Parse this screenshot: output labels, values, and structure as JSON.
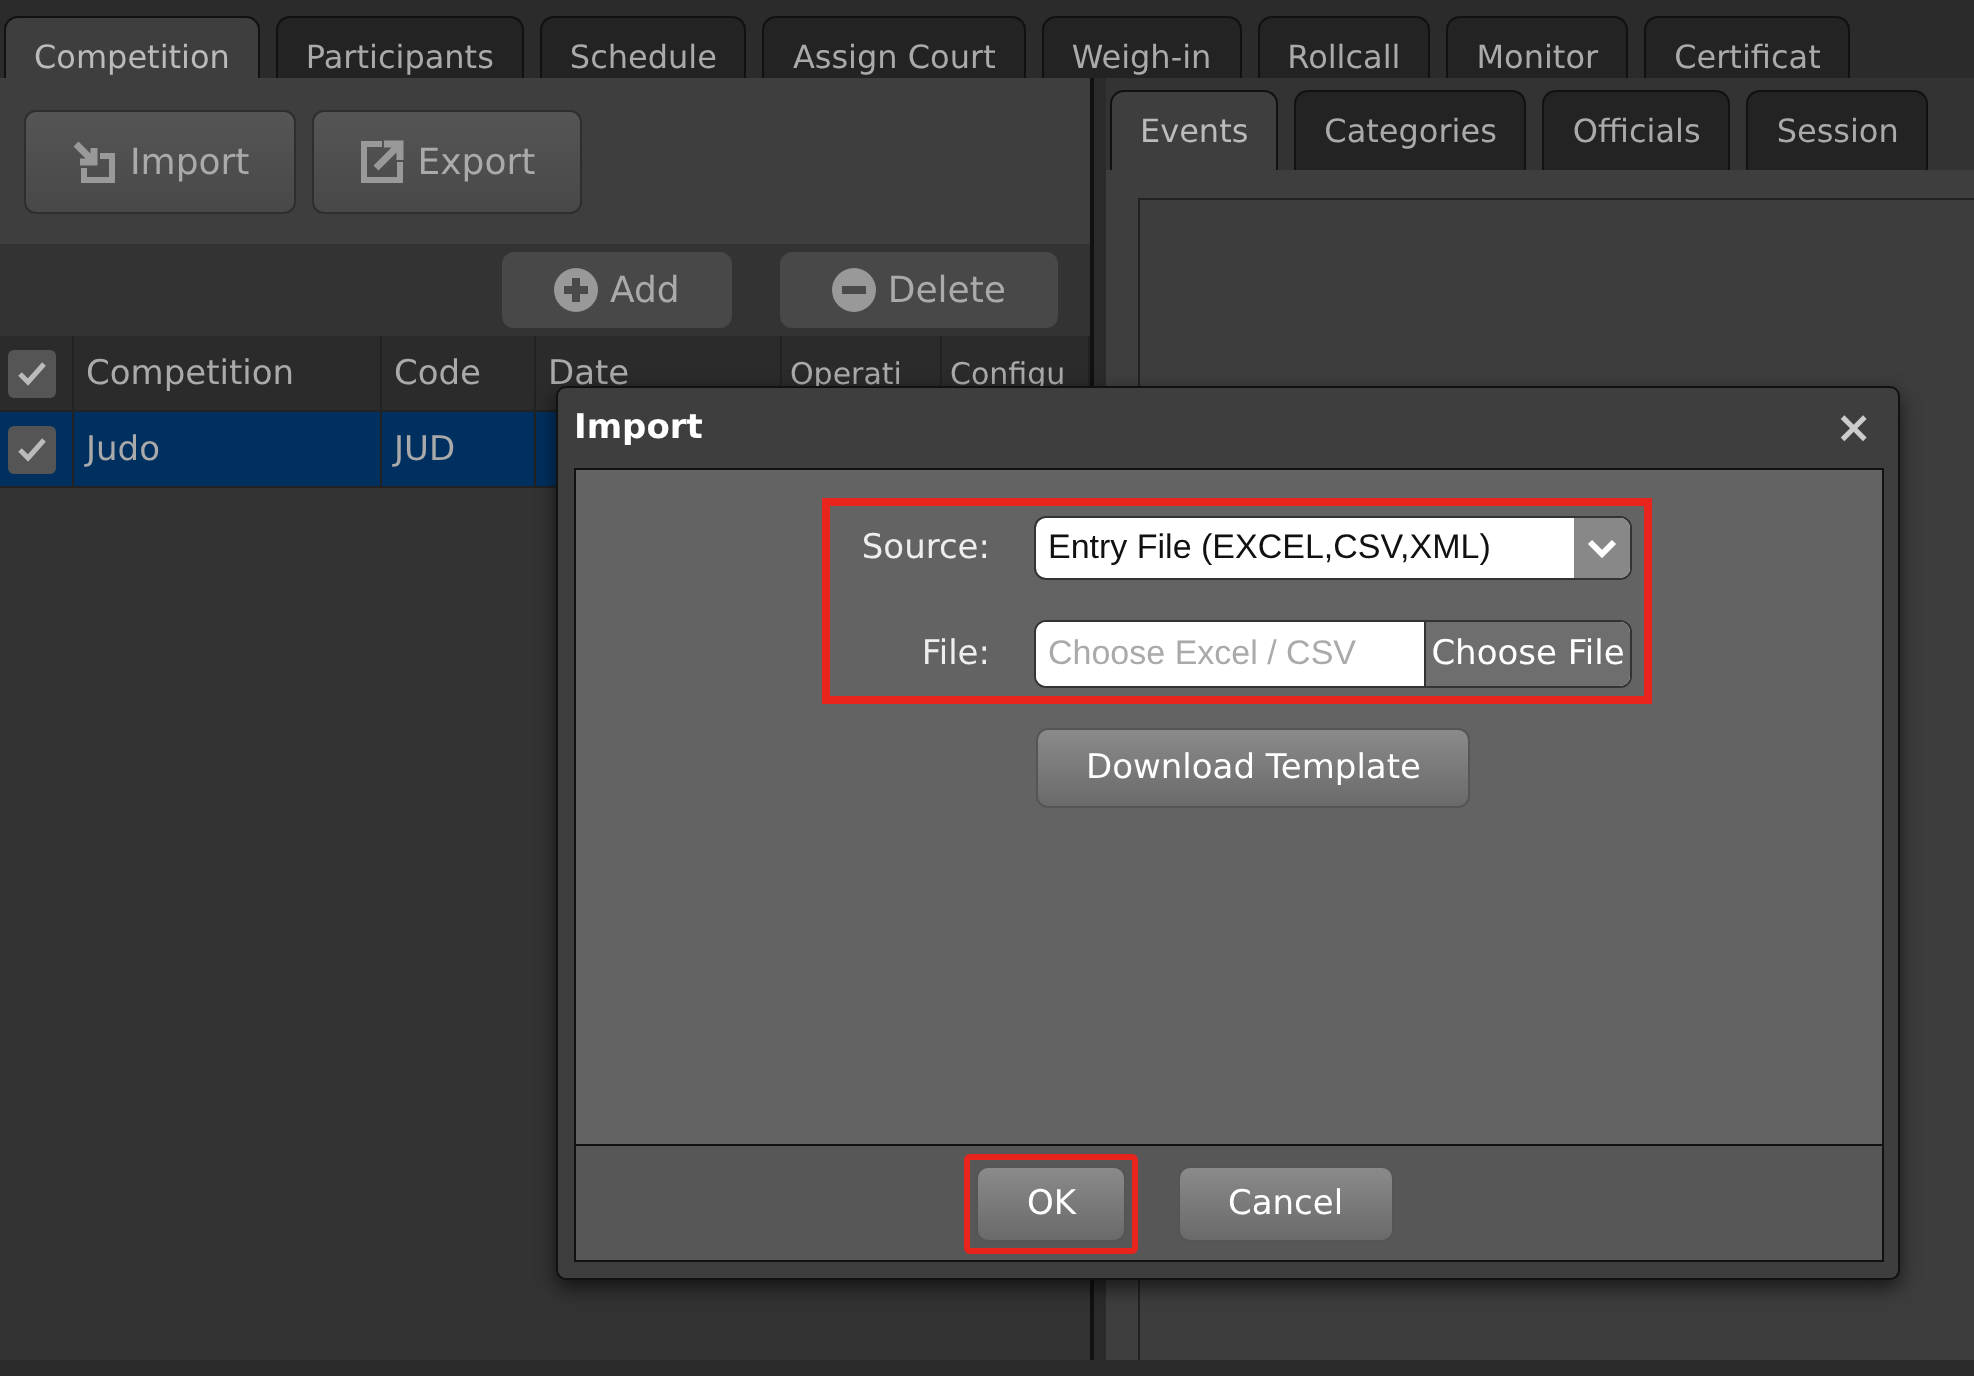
{
  "main_tabs": [
    {
      "label": "Competition",
      "selected": true
    },
    {
      "label": "Participants",
      "selected": false
    },
    {
      "label": "Schedule",
      "selected": false
    },
    {
      "label": "Assign Court",
      "selected": false
    },
    {
      "label": "Weigh-in",
      "selected": false
    },
    {
      "label": "Rollcall",
      "selected": false
    },
    {
      "label": "Monitor",
      "selected": false
    },
    {
      "label": "Certificat",
      "selected": false
    }
  ],
  "toolbar": [
    {
      "label": "Import",
      "kind": "import"
    },
    {
      "label": "Export",
      "kind": "export"
    }
  ],
  "table_actions": [
    {
      "label": "Add",
      "kind": "add"
    },
    {
      "label": "Delete",
      "kind": "delete"
    }
  ],
  "table": {
    "all_checked": true,
    "columns": [
      "Competition",
      "Code",
      "Date",
      "Operati",
      "Configu"
    ],
    "rows": [
      {
        "checked": true,
        "selected": true,
        "cells": [
          "Judo",
          "JUD"
        ]
      }
    ]
  },
  "sub_tabs": [
    {
      "label": "Events",
      "selected": true
    },
    {
      "label": "Categories",
      "selected": false
    },
    {
      "label": "Officials",
      "selected": false
    },
    {
      "label": "Session",
      "selected": false
    }
  ],
  "dialog": {
    "title": "Import",
    "close": "×",
    "highlighted": true,
    "source": {
      "label": "Source:",
      "value": "Entry File (EXCEL,CSV,XML)"
    },
    "file": {
      "label": "File:",
      "placeholder": "Choose Excel / CSV",
      "button": "Choose File"
    },
    "template_button": "Download Template",
    "buttons": [
      {
        "label": "OK",
        "highlighted": true
      },
      {
        "label": "Cancel",
        "highlighted": false
      }
    ]
  }
}
